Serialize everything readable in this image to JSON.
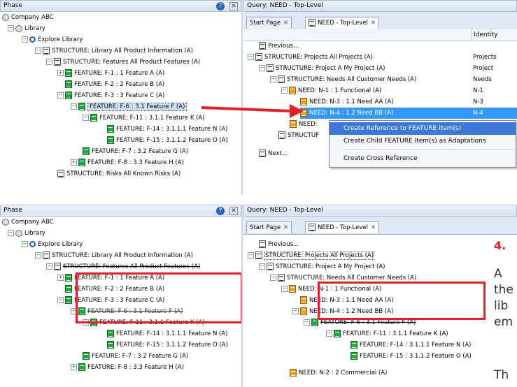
{
  "top": {
    "left_panel": {
      "title": "Phase",
      "help_icon": "question-mark-icon",
      "close_icon": "close-icon",
      "tree": [
        {
          "label": "Company ABC",
          "icon": "gear-icon"
        },
        {
          "label": "Library",
          "icon": "gear-icon"
        },
        {
          "label": "Explore Library",
          "icon": "magnifier-icon"
        },
        {
          "label": "STRUCTURE: Library  All Product Information (A)",
          "icon": "doc-icon"
        },
        {
          "label": "STRUCTURE: Features  All Product Features (A)",
          "icon": "doc-icon"
        },
        {
          "label": "FEATURE: F-1 : 1 Feature A (A)",
          "icon": "green-feature-icon"
        },
        {
          "label": "FEATURE: F-2 : 2 Feature B (A)",
          "icon": "green-feature-icon"
        },
        {
          "label": "FEATURE: F-3 : 3 Feature C (A)",
          "icon": "green-feature-icon"
        },
        {
          "label": "FEATURE: F-6 : 3.1 Feature F (A)",
          "icon": "green-feature-icon"
        },
        {
          "label": "FEATURE: F-11 : 3.1.1 Feature K (A)",
          "icon": "green-feature-icon"
        },
        {
          "label": "FEATURE: F-14 : 3.1.1.1 Feature N (A)",
          "icon": "green-feature-icon"
        },
        {
          "label": "FEATURE: F-15 : 3.1.1.2 Feature O (A)",
          "icon": "green-feature-icon"
        },
        {
          "label": "FEATURE: F-7 : 3.2 Feature G (A)",
          "icon": "green-feature-icon"
        },
        {
          "label": "FEATURE: F-8 : 3.3 Feature H (A)",
          "icon": "green-feature-icon"
        },
        {
          "label": "STRUCTURE: Risks  All Known Risks (A)",
          "icon": "doc-icon"
        }
      ]
    },
    "right_panel": {
      "query_title": "Query: NEED - Top-Level",
      "tabs": [
        {
          "label": "Start Page"
        },
        {
          "label": "NEED - Top-Level"
        }
      ],
      "column_header": "Identity",
      "tree": [
        {
          "label": "Previous...",
          "id": ""
        },
        {
          "label": "STRUCTURE: Projects  All Projects (A)",
          "id": "Projects"
        },
        {
          "label": "STRUCTURE: Project A  My Project (A)",
          "id": "Project"
        },
        {
          "label": "STRUCTURE: Needs  All Customer Needs (A)",
          "id": "Needs"
        },
        {
          "label": "NEED: N-1 : 1 Functional (A)",
          "id": "N-1"
        },
        {
          "label": "NEED: N-3 : 1.1 Need AA (A)",
          "id": "N-3"
        },
        {
          "label": "NEED: N-4 : 1.2 Need BB (A)",
          "id": "N-4"
        },
        {
          "label": "NEED:",
          "id": ""
        },
        {
          "label": "STRUCTUF",
          "id": ""
        },
        {
          "label": "Next...",
          "id": ""
        }
      ],
      "context_menu": [
        "Create Reference to FEATURE Item(s)",
        "Create Child FEATURE Item(s) as Adaptations",
        "Create Cross Reference"
      ]
    }
  },
  "bottom": {
    "left_panel": {
      "title": "Phase",
      "tree": [
        {
          "label": "Company ABC"
        },
        {
          "label": "Library"
        },
        {
          "label": "Explore Library"
        },
        {
          "label": "STRUCTURE: Library  All Product Information (A)"
        },
        {
          "label": "STRUCTURE: Features  All Product Features (A)"
        },
        {
          "label": "FEATURE: F-1 : 1 Feature A (A)"
        },
        {
          "label": "FEATURE: F-2 : 2 Feature B (A)"
        },
        {
          "label": "FEATURE: F-3 : 3 Feature C (A)"
        },
        {
          "label": "FEATURE: F-6 : 3.1 Feature F (A)"
        },
        {
          "label": "FEATURE: F-11 : 3.1.1 Feature K (A)"
        },
        {
          "label": "FEATURE: F-14 : 3.1.1.1 Feature N (A)"
        },
        {
          "label": "FEATURE: F-15 : 3.1.1.2 Feature O (A)"
        },
        {
          "label": "FEATURE: F-7 : 3.2 Feature G (A)"
        },
        {
          "label": "FEATURE: F-8 : 3.3 Feature H (A)"
        }
      ]
    },
    "right_panel": {
      "query_title": "Query: NEED - Top-Level",
      "tabs": [
        {
          "label": "Start Page"
        },
        {
          "label": "NEED - Top-Level"
        }
      ],
      "tree": [
        {
          "label": "Previous..."
        },
        {
          "label": "STRUCTURE: Projects  All Projects (A)"
        },
        {
          "label": "STRUCTURE: Project A  My Project (A)"
        },
        {
          "label": "STRUCTURE: Needs  All Customer Needs (A)"
        },
        {
          "label": "NEED: N-1 : 1 Functional (A)"
        },
        {
          "label": "NEED: N-3 : 1.1 Need AA (A)"
        },
        {
          "label": "NEED: N-4 : 1.2 Need BB (A)"
        },
        {
          "label": "FEATURE: F-6 : 3.1 Feature F (A)"
        },
        {
          "label": "FEATURE: F-11 : 3.1.1 Feature K (A)"
        },
        {
          "label": "FEATURE: F-14 : 3.1.1.1 Feature N (A)"
        },
        {
          "label": "FEATURE: F-15 : 3.1.1.2 Feature O (A)"
        },
        {
          "label": "NEED: N-2 : 2 Commercial (A)"
        }
      ]
    }
  },
  "side_text": {
    "step": "4.",
    "line1": "A",
    "line2": "the",
    "line3": "lib",
    "line4": "em",
    "line5": "Th"
  },
  "colors": {
    "highlight": "#e0202a",
    "selection": "#3399ff",
    "menu_highlight": "#3c78d8"
  }
}
